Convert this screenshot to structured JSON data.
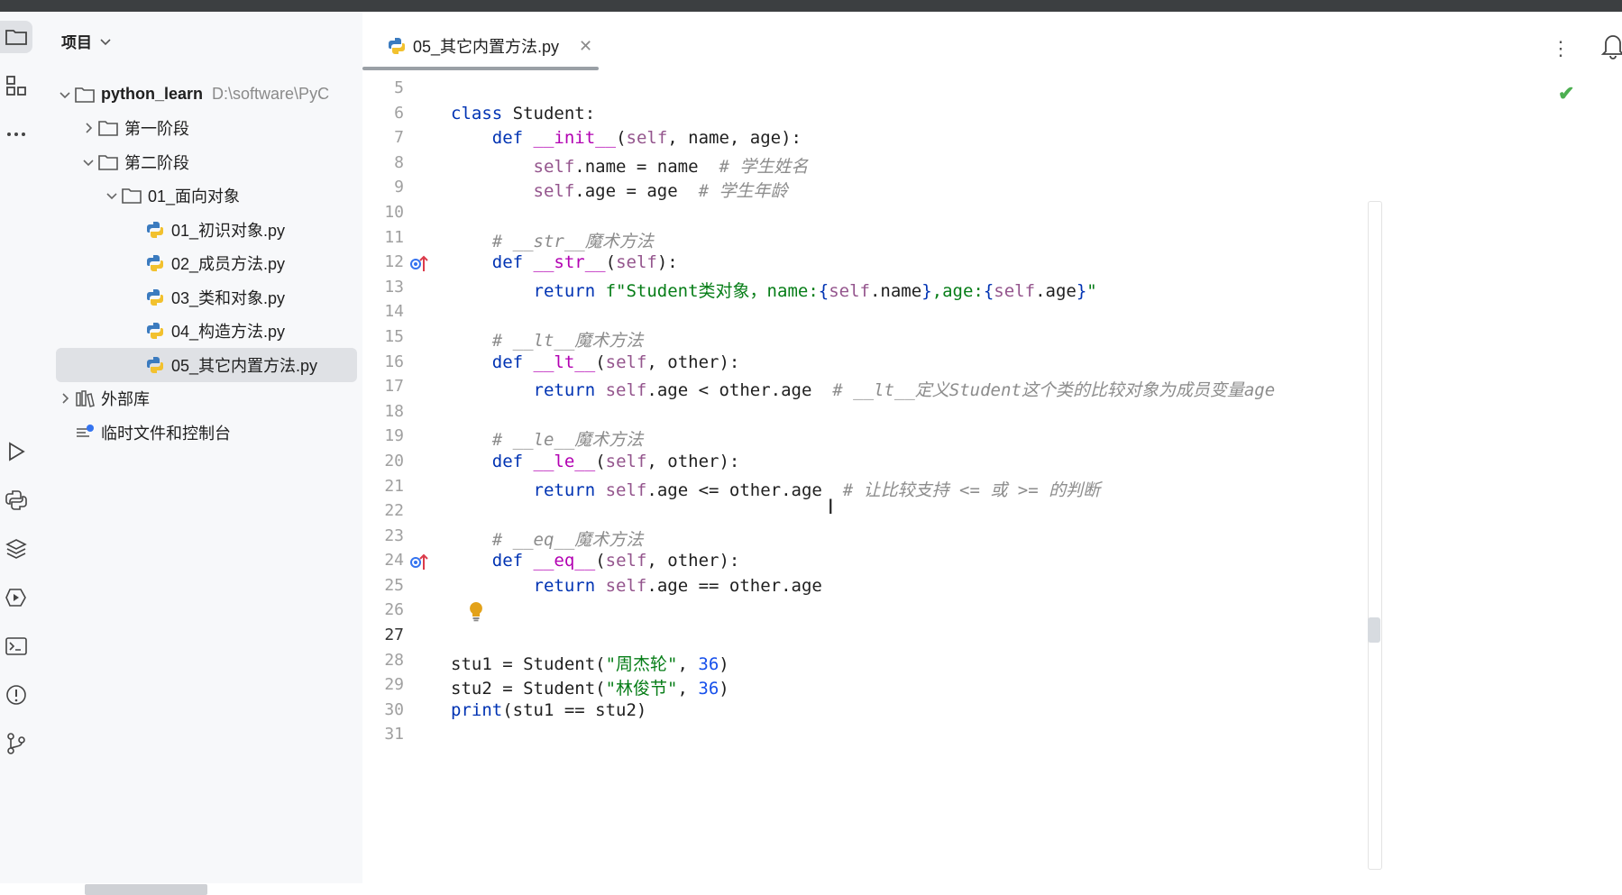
{
  "project_panel": {
    "title": "项目",
    "tree": [
      {
        "label": "python_learn",
        "path": "D:\\software\\PyC",
        "level": 0,
        "type": "folder",
        "expanded": true
      },
      {
        "label": "第一阶段",
        "level": 1,
        "type": "folder",
        "expanded": false
      },
      {
        "label": "第二阶段",
        "level": 1,
        "type": "folder",
        "expanded": true
      },
      {
        "label": "01_面向对象",
        "level": 2,
        "type": "folder",
        "expanded": true
      },
      {
        "label": "01_初识对象.py",
        "level": 3,
        "type": "python-file"
      },
      {
        "label": "02_成员方法.py",
        "level": 3,
        "type": "python-file"
      },
      {
        "label": "03_类和对象.py",
        "level": 3,
        "type": "python-file"
      },
      {
        "label": "04_构造方法.py",
        "level": 3,
        "type": "python-file"
      },
      {
        "label": "05_其它内置方法.py",
        "level": 3,
        "type": "python-file",
        "selected": true
      },
      {
        "label": "外部库",
        "level": 0,
        "type": "library",
        "expanded": false
      },
      {
        "label": "临时文件和控制台",
        "level": 0,
        "type": "scratch"
      }
    ]
  },
  "editor": {
    "active_tab": "05_其它内置方法.py",
    "current_line": "27",
    "line_numbers": [
      "5",
      "6",
      "7",
      "8",
      "9",
      "10",
      "11",
      "12",
      "13",
      "14",
      "15",
      "16",
      "17",
      "18",
      "19",
      "20",
      "21",
      "22",
      "23",
      "24",
      "25",
      "26",
      "27",
      "28",
      "29",
      "30",
      "31"
    ],
    "tokens": {
      "l6": [
        "class",
        " Student:"
      ],
      "l7": [
        "    ",
        "def",
        " ",
        "__init__",
        "(",
        "self",
        ", name, age):"
      ],
      "l8": [
        "        ",
        "self",
        ".name = name  ",
        "# 学生姓名"
      ],
      "l9": [
        "        ",
        "self",
        ".age = age  ",
        "# 学生年龄"
      ],
      "l11": [
        "    ",
        "# __str__魔术方法"
      ],
      "l12": [
        "    ",
        "def",
        " ",
        "__str__",
        "(",
        "self",
        "):"
      ],
      "l13": [
        "        ",
        "return",
        " ",
        "f\"Student类对象，name:",
        "{",
        "self",
        ".name",
        "}",
        ",age:",
        "{",
        "self",
        ".age",
        "}",
        "\""
      ],
      "l15": [
        "    ",
        "# __lt__魔术方法"
      ],
      "l16": [
        "    ",
        "def",
        " ",
        "__lt__",
        "(",
        "self",
        ", other):"
      ],
      "l17": [
        "        ",
        "return",
        " ",
        "self",
        ".age < other.age  ",
        "# __lt__定义Student这个类的比较对象为成员变量age"
      ],
      "l19": [
        "    ",
        "# __le__魔术方法"
      ],
      "l20": [
        "    ",
        "def",
        " ",
        "__le__",
        "(",
        "self",
        ", other):"
      ],
      "l21": [
        "        ",
        "return",
        " ",
        "self",
        ".age <= other.age  ",
        "# 让比较支持 <= 或 >= 的判断"
      ],
      "l23": [
        "    ",
        "# __eq__魔术方法"
      ],
      "l24": [
        "    ",
        "def",
        " ",
        "__eq__",
        "(",
        "self",
        ", other):"
      ],
      "l25": [
        "        ",
        "return",
        " ",
        "self",
        ".age == other.age"
      ],
      "l28": [
        "stu1 = Student(",
        "\"周杰轮\"",
        ", ",
        "36",
        ")"
      ],
      "l29": [
        "stu2 = Student(",
        "\"林俊节\"",
        ", ",
        "36",
        ")"
      ],
      "l30": [
        "print",
        "(stu1 == stu2)"
      ]
    }
  },
  "colors": {
    "keyword": "#0033b3",
    "self": "#94558d",
    "dunder": "#b200b2",
    "string": "#067d17",
    "number": "#1750eb",
    "comment": "#8c8c8c",
    "override_marker": "#3574f0",
    "check": "#4caf50"
  },
  "icons": [
    "folder-icon",
    "structure-icon",
    "more-icon",
    "run-icon",
    "python-console-icon",
    "layers-icon",
    "services-icon",
    "terminal-icon",
    "problems-icon",
    "git-icon",
    "bell-icon",
    "bulb-icon",
    "override-icon"
  ]
}
